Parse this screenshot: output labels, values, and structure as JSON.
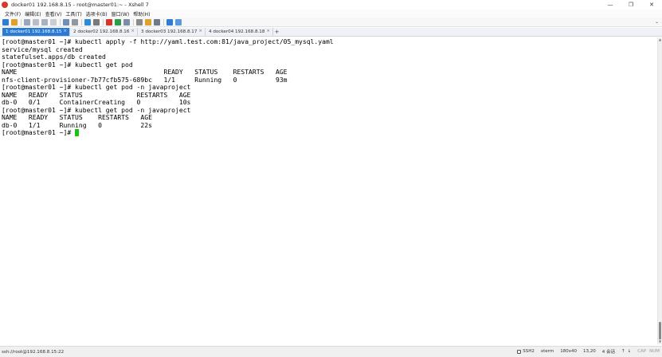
{
  "window": {
    "title": "docker01 192.168.8.15 - root@master01:~ - Xshell 7",
    "minimize_glyph": "—",
    "maximize_glyph": "❐",
    "close_glyph": "✕"
  },
  "menu": {
    "items": [
      "文件(F)",
      "编辑(E)",
      "查看(V)",
      "工具(T)",
      "选项卡(B)",
      "窗口(W)",
      "帮助(H)"
    ]
  },
  "toolbar": {
    "icons": [
      {
        "name": "new-session-icon",
        "color": "#2f7bd6"
      },
      {
        "name": "open-folder-icon",
        "color": "#e0a030"
      },
      {
        "name": "reconnect-icon",
        "color": "#9aa7b8"
      },
      {
        "name": "disconnect-icon",
        "color": "#b8bec8"
      },
      {
        "name": "copy-icon",
        "color": "#a9b2bd"
      },
      {
        "name": "paste-icon",
        "color": "#c8cdd4"
      },
      {
        "name": "find-icon",
        "color": "#6f8fb7"
      },
      {
        "name": "print-icon",
        "color": "#9097a0"
      },
      {
        "name": "globe-icon",
        "color": "#2a8bd8"
      },
      {
        "name": "font-icon",
        "color": "#7a7a7a"
      },
      {
        "name": "color-scheme-icon",
        "color": "#d8342a"
      },
      {
        "name": "transfer-icon",
        "color": "#2c9b4b"
      },
      {
        "name": "fullscreen-icon",
        "color": "#7b8ea5"
      },
      {
        "name": "lock-icon",
        "color": "#8a8a8a"
      },
      {
        "name": "keyboard-icon",
        "color": "#e0a030"
      },
      {
        "name": "layout-icon",
        "color": "#6c7a8c"
      },
      {
        "name": "help-icon",
        "color": "#2f7bd6"
      },
      {
        "name": "chat-icon",
        "color": "#5a9ad8"
      }
    ],
    "collapse_glyph": "⌄"
  },
  "tabs": {
    "items": [
      {
        "label": "1 docker01 192.168.8.15",
        "active": true
      },
      {
        "label": "2 docker02 192.168.8.16",
        "active": false
      },
      {
        "label": "3 docker03 192.168.8.17",
        "active": false
      },
      {
        "label": "4 docker04 192.168.8.18",
        "active": false
      }
    ],
    "close_glyph": "×",
    "add_glyph": "+"
  },
  "terminal": {
    "lines": [
      "[root@master01 ~]# kubectl apply -f http://yaml.test.com:81/java_project/05_mysql.yaml",
      "service/mysql created",
      "statefulset.apps/db created",
      "[root@master01 ~]# kubectl get pod",
      "NAME                                      READY   STATUS    RESTARTS   AGE",
      "nfs-client-provisioner-7b77cfb575-689bc   1/1     Running   0          93m",
      "[root@master01 ~]# kubectl get pod -n javaproject",
      "NAME   READY   STATUS              RESTARTS   AGE",
      "db-0   0/1     ContainerCreating   0          10s",
      "[root@master01 ~]# kubectl get pod -n javaproject",
      "NAME   READY   STATUS    RESTARTS   AGE",
      "db-0   1/1     Running   0          22s"
    ],
    "prompt": "[root@master01 ~]# ",
    "cursor_color": "#16c60c"
  },
  "scrollbar": {
    "up_glyph": "▲",
    "down_glyph": "▼"
  },
  "status": {
    "connection": "ssh://root@192.168.8.15:22",
    "protocol": "SSH2",
    "terminal_type": "xterm",
    "size": "180x40",
    "cursor_pos": "13,20",
    "sessions": "4 会话",
    "nav_up": "↑",
    "nav_down": "↓",
    "cap": "CAP",
    "num": "NUM"
  }
}
